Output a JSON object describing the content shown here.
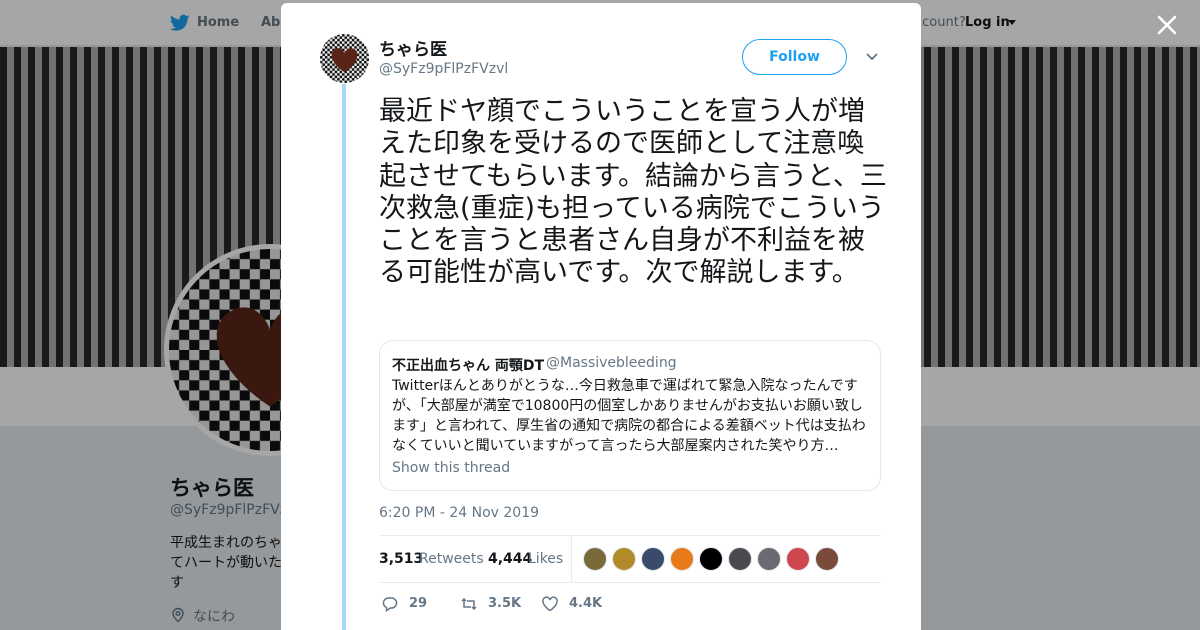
{
  "nav": {
    "home": "Home",
    "about": "Abo",
    "account_prompt": "ccount?",
    "login": "Log in",
    "logo_icon": "twitter-bird-icon",
    "brand_color": "#1da1f2"
  },
  "profile": {
    "name": "ちゃら医",
    "handle": "@SyFz9pFlPzFVz",
    "bio": "平成生まれのちゃ\nてハートが動いた\nす",
    "location": "なにわ"
  },
  "tweet": {
    "author_name": "ちゃら医",
    "author_handle": "@SyFz9pFlPzFVzvl",
    "follow_label": "Follow",
    "text": "最近ドヤ顔でこういうことを宣う人が増えた印象を受けるので医師として注意喚起させてもらいます。結論から言うと、三次救急(重症)も担っている病院でこういうことを言うと患者さん自身が不利益を被る可能性が高いです。次で解説します。",
    "timestamp": "6:20 PM - 24 Nov 2019"
  },
  "quote": {
    "name": "不正出血ちゃん 両顎DT",
    "handle": "@Massivebleeding",
    "text": "Twitterほんとありがとうな…今日救急車で運ばれて緊急入院なったんですが、「大部屋が満室で10800円の個室しかありませんがお支払いお願い致します」と言われて、厚生省の通知で病院の都合による差額ベット代は支払わなくていいと聞いていますがって言ったら大部屋案内された笑やり方…",
    "show_thread": "Show this thread"
  },
  "stats": {
    "retweets": "3,513",
    "retweets_label": "Retweets",
    "likes": "4,444",
    "likes_label": "Likes",
    "likers": [
      {
        "color": "#7a6a3a",
        "name": "liker-avatar-1"
      },
      {
        "color": "#b38a2a",
        "name": "liker-avatar-2"
      },
      {
        "color": "#3a4a6a",
        "name": "liker-avatar-3"
      },
      {
        "color": "#e87a1a",
        "name": "liker-avatar-4"
      },
      {
        "color": "#000000",
        "name": "liker-avatar-5"
      },
      {
        "color": "#4a4a50",
        "name": "liker-avatar-6"
      },
      {
        "color": "#6a6a72",
        "name": "liker-avatar-7"
      },
      {
        "color": "#d0464e",
        "name": "liker-avatar-8"
      },
      {
        "color": "#7a4a3a",
        "name": "liker-avatar-9"
      }
    ]
  },
  "actions": {
    "replies": "29",
    "retweets": "3.5K",
    "likes": "4.4K",
    "reply_icon": "reply-icon",
    "retweet_icon": "retweet-icon",
    "like_icon": "heart-icon"
  },
  "close_icon": "close-icon"
}
